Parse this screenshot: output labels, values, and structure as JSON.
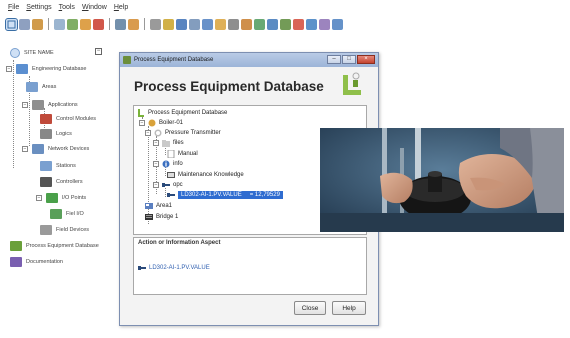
{
  "menu": [
    "File",
    "Settings",
    "Tools",
    "Window",
    "Help"
  ],
  "toolbar": {
    "icons": [
      {
        "name": "select-icon",
        "color": "#3a6ea5"
      },
      {
        "name": "tree-icon",
        "color": "#7a8fb5"
      },
      {
        "name": "search-icon",
        "color": "#c98a2b"
      },
      {
        "name": "document-icon",
        "color": "#8aa8c8"
      },
      {
        "name": "chart-icon",
        "color": "#6aa04a"
      },
      {
        "name": "refresh-icon",
        "color": "#d8902a"
      },
      {
        "name": "stop-icon",
        "color": "#c93a2a"
      },
      {
        "name": "grid-icon",
        "color": "#5b7d9e"
      },
      {
        "name": "filter-icon",
        "color": "#d28a2f"
      },
      {
        "name": "record-icon",
        "color": "#888888"
      },
      {
        "name": "key-icon",
        "color": "#c9a227"
      },
      {
        "name": "table-icon",
        "color": "#3b6fb5"
      },
      {
        "name": "list-icon",
        "color": "#6d8cb3"
      },
      {
        "name": "export-icon",
        "color": "#4f7fc0"
      },
      {
        "name": "arrow-icon",
        "color": "#d9a23a"
      },
      {
        "name": "print-icon",
        "color": "#7a7a7a"
      },
      {
        "name": "magnify-icon",
        "color": "#c77b2b"
      },
      {
        "name": "image-icon",
        "color": "#4e9a5c"
      },
      {
        "name": "monitor-icon",
        "color": "#3e77b8"
      },
      {
        "name": "trend-icon",
        "color": "#5a8a3a"
      },
      {
        "name": "alarm-icon",
        "color": "#d24a3a"
      },
      {
        "name": "network-icon",
        "color": "#3f7fc1"
      },
      {
        "name": "settings-icon",
        "color": "#8b6fb3"
      },
      {
        "name": "help-icon",
        "color": "#4a7fc0"
      }
    ]
  },
  "left_tree": {
    "root": "SITE NAME",
    "items": [
      {
        "label": "Engineering Database",
        "color": "#5b8fd0"
      },
      {
        "label": "Areas",
        "color": "#7aa0d0"
      },
      {
        "label": "Applications",
        "color": "#8f8f8f"
      },
      {
        "label": "Control Modules",
        "color": "#c04a3a"
      },
      {
        "label": "Logics",
        "color": "#888888"
      },
      {
        "label": "Network Devices",
        "color": "#6a8fc0"
      },
      {
        "label": "Stations",
        "color": "#7aa0d0"
      },
      {
        "label": "Controllers",
        "color": "#555555"
      },
      {
        "label": "I/O Points",
        "color": "#4aa04a"
      },
      {
        "label": "Fiel I/O",
        "color": "#5aa05a"
      },
      {
        "label": "Field Devices",
        "color": "#9a9a9a"
      },
      {
        "label": "Process Equipment Database",
        "color": "#6aa03a"
      },
      {
        "label": "Documentation",
        "color": "#7a5fb0"
      }
    ]
  },
  "dialog": {
    "window_title": "Process Equipment Database",
    "heading": "Process Equipment Database",
    "tree": {
      "root": "Process Equipment Database",
      "boiler": "Boiler-01",
      "transmitter": "Pressure Transmitter",
      "files": "files",
      "manual": "Manual",
      "info": "info",
      "knowledge": "Maintenance Knowledge",
      "opc": "opc",
      "opc_item": "LD302-AI-1.PV.VALUE",
      "opc_value": "= 12,79529",
      "area": "Area1",
      "bridge": "Bridge 1"
    },
    "aspect": {
      "title": "Action or Information Aspect",
      "link": "LD302-AI-1.PV.VALUE"
    },
    "buttons": {
      "close": "Close",
      "help": "Help"
    }
  }
}
